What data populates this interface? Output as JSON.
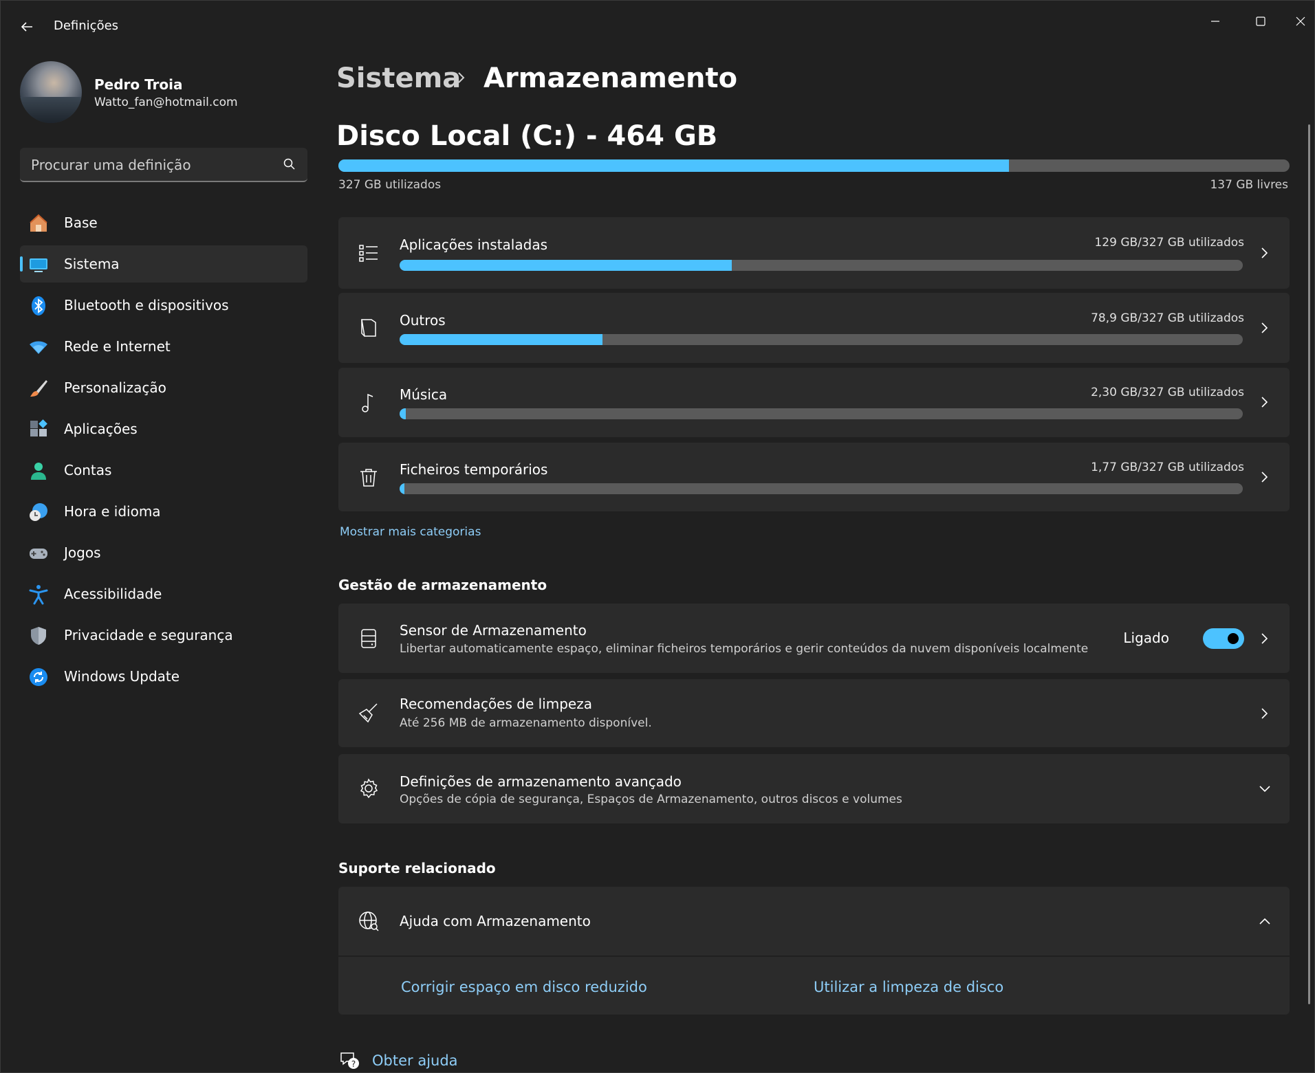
{
  "window": {
    "app_title": "Definições"
  },
  "profile": {
    "name": "Pedro Troia",
    "email": "Watto_fan@hotmail.com"
  },
  "search": {
    "placeholder": "Procurar uma definição"
  },
  "nav": {
    "items": [
      {
        "label": "Base",
        "icon": "home-icon",
        "selected": false
      },
      {
        "label": "Sistema",
        "icon": "system-icon",
        "selected": true
      },
      {
        "label": "Bluetooth e dispositivos",
        "icon": "bluetooth-icon",
        "selected": false
      },
      {
        "label": "Rede e Internet",
        "icon": "wifi-icon",
        "selected": false
      },
      {
        "label": "Personalização",
        "icon": "brush-icon",
        "selected": false
      },
      {
        "label": "Aplicações",
        "icon": "apps-icon",
        "selected": false
      },
      {
        "label": "Contas",
        "icon": "account-icon",
        "selected": false
      },
      {
        "label": "Hora e idioma",
        "icon": "time-language-icon",
        "selected": false
      },
      {
        "label": "Jogos",
        "icon": "gamepad-icon",
        "selected": false
      },
      {
        "label": "Acessibilidade",
        "icon": "accessibility-icon",
        "selected": false
      },
      {
        "label": "Privacidade e segurança",
        "icon": "shield-icon",
        "selected": false
      },
      {
        "label": "Windows Update",
        "icon": "update-icon",
        "selected": false
      }
    ]
  },
  "breadcrumb": {
    "parent": "Sistema",
    "current": "Armazenamento"
  },
  "disk": {
    "title": "Disco Local (C:) - 464 GB",
    "used_label": "327 GB utilizados",
    "free_label": "137 GB livres",
    "used_fraction": 0.705
  },
  "categories": [
    {
      "label": "Aplicações instaladas",
      "usage": "129 GB/327 GB utilizados",
      "fraction": 0.394,
      "icon": "apps-list-icon"
    },
    {
      "label": "Outros",
      "usage": "78,9 GB/327 GB utilizados",
      "fraction": 0.241,
      "icon": "other-files-icon"
    },
    {
      "label": "Música",
      "usage": "2,30 GB/327 GB utilizados",
      "fraction": 0.007,
      "icon": "music-note-icon"
    },
    {
      "label": "Ficheiros temporários",
      "usage": "1,77 GB/327 GB utilizados",
      "fraction": 0.005,
      "icon": "trash-icon"
    }
  ],
  "more_categories": "Mostrar mais categorias",
  "management": {
    "heading": "Gestão de armazenamento",
    "sensor": {
      "title": "Sensor de Armazenamento",
      "desc": "Libertar automaticamente espaço, eliminar ficheiros temporários e gerir conteúdos da nuvem disponíveis localmente",
      "toggle_label": "Ligado",
      "on": true
    },
    "cleanup": {
      "title": "Recomendações de limpeza",
      "desc": "Até 256 MB de armazenamento disponível."
    },
    "advanced": {
      "title": "Definições de armazenamento avançado",
      "desc": "Opções de cópia de segurança, Espaços de Armazenamento, outros discos e volumes"
    }
  },
  "support": {
    "heading": "Suporte relacionado",
    "help_title": "Ajuda com Armazenamento",
    "links": [
      "Corrigir espaço em disco reduzido",
      "Utilizar a limpeza de disco"
    ]
  },
  "get_help": "Obter ajuda",
  "colors": {
    "accent": "#4cc2ff",
    "link": "#8ecdf7",
    "background": "#202020",
    "card": "#2b2b2b"
  }
}
